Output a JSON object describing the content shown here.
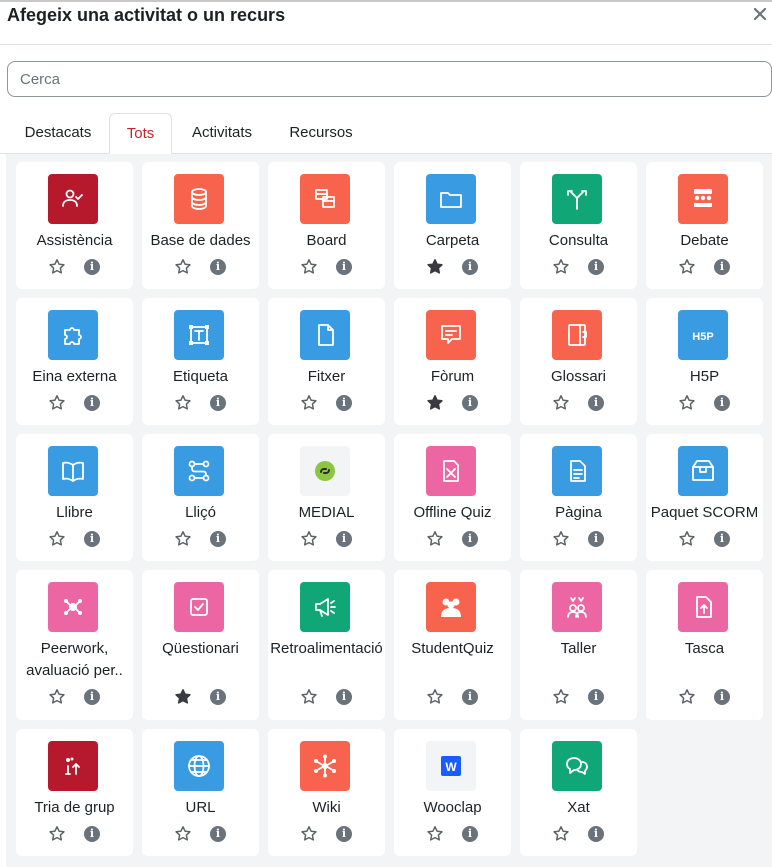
{
  "modal": {
    "title": "Afegeix una activitat o un recurs",
    "close_icon": "close-icon"
  },
  "search": {
    "placeholder": "Cerca",
    "value": ""
  },
  "tabs": [
    {
      "label": "Destacats",
      "active": false
    },
    {
      "label": "Tots",
      "active": true
    },
    {
      "label": "Activitats",
      "active": false
    },
    {
      "label": "Recursos",
      "active": false
    }
  ],
  "colors": {
    "red": "#b5192b",
    "orange": "#f7634d",
    "blue": "#399be2",
    "green": "#11a676",
    "pink": "#eb66a2",
    "active_tab": "#c0262d",
    "icon_grey": "#6a737b"
  },
  "items": [
    {
      "label": "Assistència",
      "icon": "attendance-icon",
      "color": "#b5192b",
      "starred": false
    },
    {
      "label": "Base de dades",
      "icon": "database-icon",
      "color": "#f7634d",
      "starred": false
    },
    {
      "label": "Board",
      "icon": "board-icon",
      "color": "#f7634d",
      "starred": false
    },
    {
      "label": "Carpeta",
      "icon": "folder-icon",
      "color": "#399be2",
      "starred": true
    },
    {
      "label": "Consulta",
      "icon": "choice-icon",
      "color": "#11a676",
      "starred": false
    },
    {
      "label": "Debate",
      "icon": "debate-icon",
      "color": "#f7634d",
      "starred": false
    },
    {
      "label": "Eina externa",
      "icon": "puzzle-icon",
      "color": "#399be2",
      "starred": false
    },
    {
      "label": "Etiqueta",
      "icon": "text-label-icon",
      "color": "#399be2",
      "starred": false
    },
    {
      "label": "Fitxer",
      "icon": "file-icon",
      "color": "#399be2",
      "starred": false
    },
    {
      "label": "Fòrum",
      "icon": "forum-icon",
      "color": "#f7634d",
      "starred": true
    },
    {
      "label": "Glossari",
      "icon": "glossary-icon",
      "color": "#f7634d",
      "starred": false
    },
    {
      "label": "H5P",
      "icon": "h5p-icon",
      "color": "#399be2",
      "starred": false,
      "icon_text": "H5P"
    },
    {
      "label": "Llibre",
      "icon": "book-icon",
      "color": "#399be2",
      "starred": false
    },
    {
      "label": "Lliçó",
      "icon": "lesson-icon",
      "color": "#399be2",
      "starred": false
    },
    {
      "label": "MEDIAL",
      "icon": "medial-icon",
      "color": "#f3f4f6",
      "starred": false
    },
    {
      "label": "Offline Quiz",
      "icon": "offline-quiz-icon",
      "color": "#eb66a2",
      "starred": false
    },
    {
      "label": "Pàgina",
      "icon": "page-icon",
      "color": "#399be2",
      "starred": false
    },
    {
      "label": "Paquet SCORM",
      "icon": "scorm-package-icon",
      "color": "#399be2",
      "starred": false
    },
    {
      "label": "Peerwork, avaluació per..",
      "icon": "peerwork-icon",
      "color": "#eb66a2",
      "starred": false
    },
    {
      "label": "Qüestionari",
      "icon": "quiz-icon",
      "color": "#eb66a2",
      "starred": true
    },
    {
      "label": "Retroalimentació",
      "icon": "feedback-icon",
      "color": "#11a676",
      "starred": false
    },
    {
      "label": "StudentQuiz",
      "icon": "studentquiz-icon",
      "color": "#f7634d",
      "starred": false
    },
    {
      "label": "Taller",
      "icon": "workshop-icon",
      "color": "#eb66a2",
      "starred": false
    },
    {
      "label": "Tasca",
      "icon": "assignment-icon",
      "color": "#eb66a2",
      "starred": false
    },
    {
      "label": "Tria de grup",
      "icon": "group-choice-icon",
      "color": "#b5192b",
      "starred": false
    },
    {
      "label": "URL",
      "icon": "globe-icon",
      "color": "#399be2",
      "starred": false
    },
    {
      "label": "Wiki",
      "icon": "wiki-icon",
      "color": "#f7634d",
      "starred": false
    },
    {
      "label": "Wooclap",
      "icon": "wooclap-icon",
      "color": "#f3f4f6",
      "starred": false,
      "icon_text": "W"
    },
    {
      "label": "Xat",
      "icon": "chat-icon",
      "color": "#11a676",
      "starred": false
    }
  ],
  "info_glyph": "i"
}
